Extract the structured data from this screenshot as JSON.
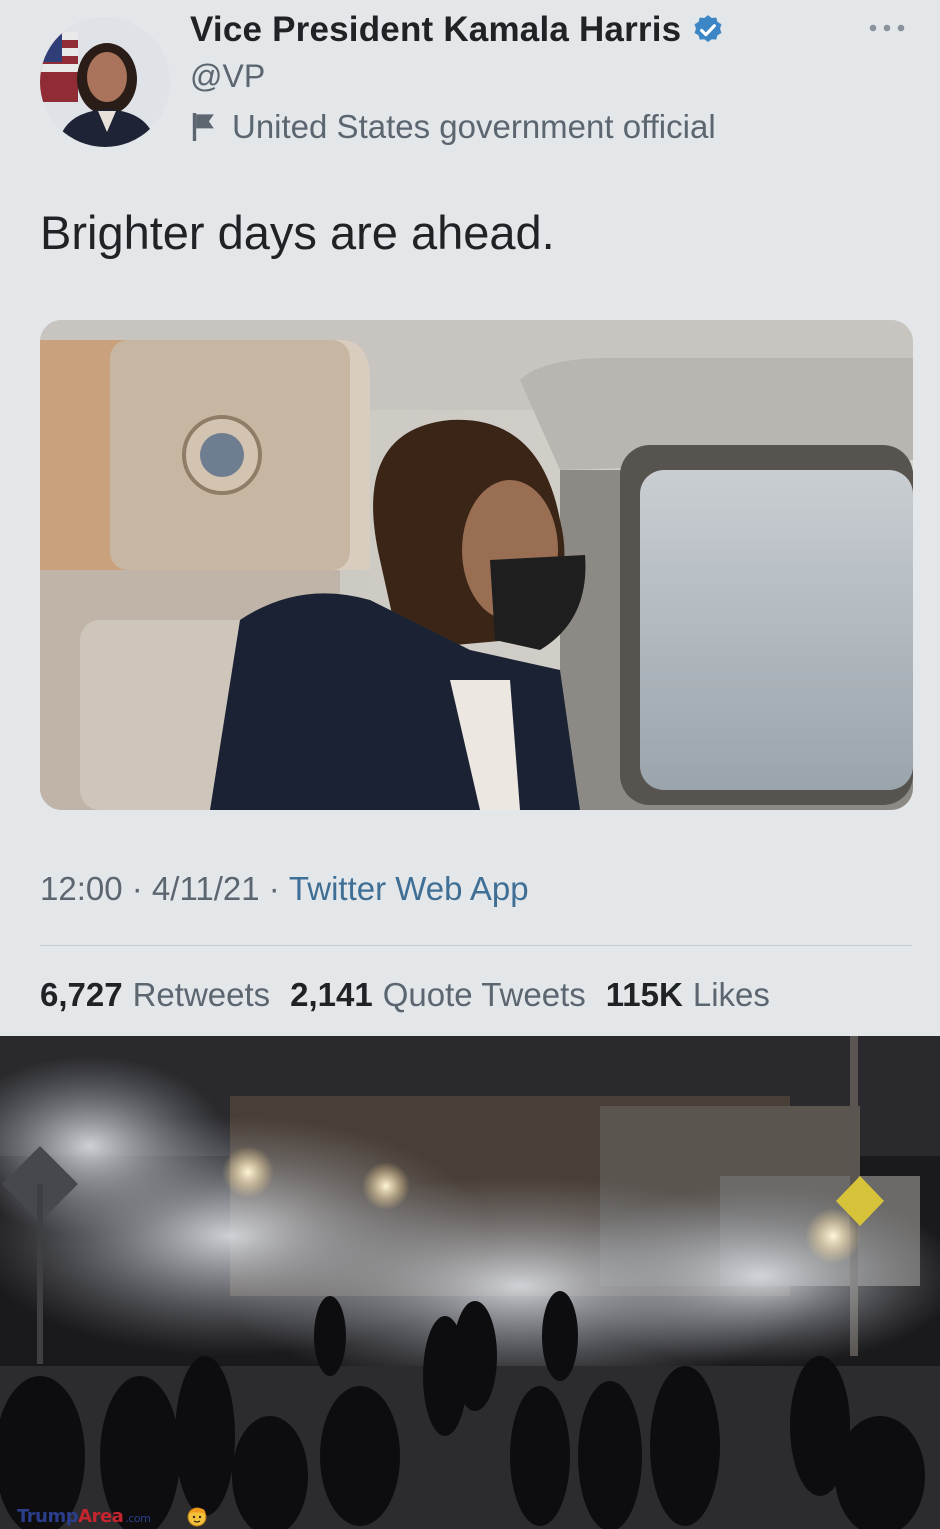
{
  "tweet": {
    "display_name": "Vice President Kamala Harris",
    "handle": "@VP",
    "account_label": "United States government official",
    "text": "Brighter days are ahead.",
    "time": "12:00",
    "date": "4/11/21",
    "source": "Twitter Web App",
    "separator": " · ",
    "stats": {
      "retweets_count": "6,727",
      "retweets_label": "Retweets",
      "quote_tweets_count": "2,141",
      "quote_tweets_label": "Quote Tweets",
      "likes_count": "115K",
      "likes_label": "Likes"
    },
    "icons": {
      "verified": "verified-badge-icon",
      "label": "flag-icon",
      "more": "more-options-icon"
    },
    "colors": {
      "verified": "#3d86c6",
      "link": "#3f6f95"
    }
  },
  "watermark": {
    "brand_part1": "Trump",
    "brand_part2": "Area",
    "brand_suffix": ".com"
  }
}
